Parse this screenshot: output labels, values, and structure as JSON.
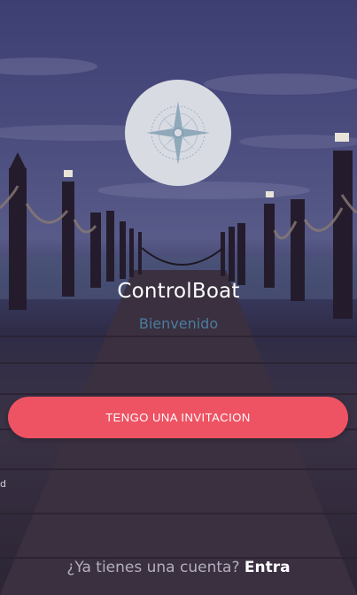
{
  "app": {
    "title": "ControlBoat",
    "subtitle": "Bienvenido"
  },
  "actions": {
    "invite_button_label": "TENGO UNA INVITACION"
  },
  "footer": {
    "prompt": "¿Ya tienes una cuenta?",
    "link_label": "Entra"
  },
  "background": {
    "description_icon": "pier-sunset-scene",
    "edge_text": "d"
  },
  "logo": {
    "icon": "compass-rose-icon"
  },
  "colors": {
    "accent": "#ee5363",
    "subtitle": "#4c7c9e",
    "logo_circle": "#d9dbe3"
  }
}
